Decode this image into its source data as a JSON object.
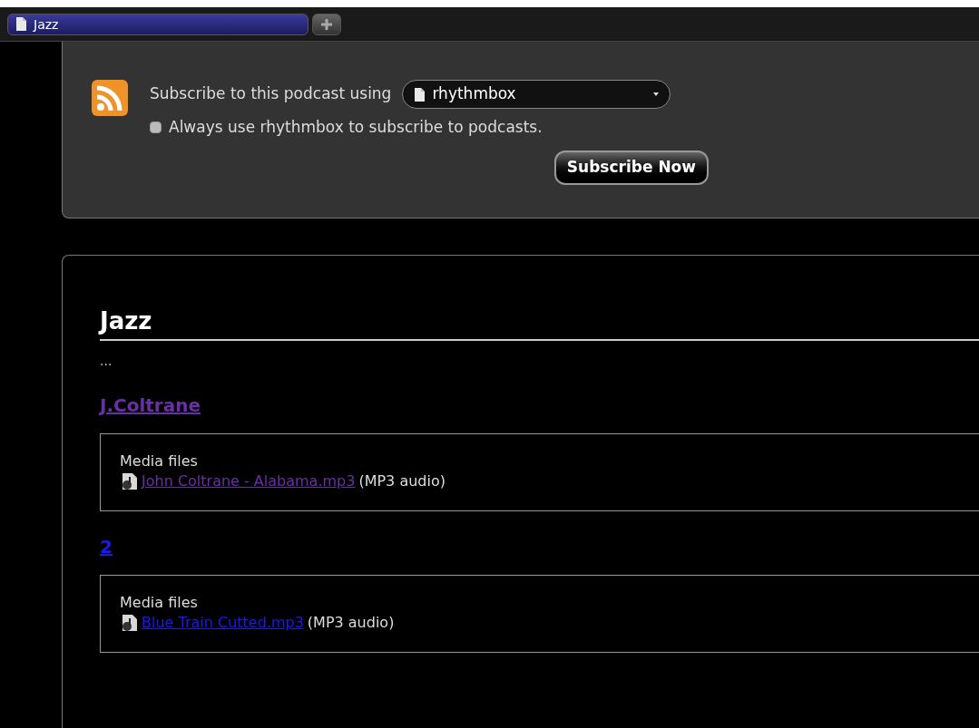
{
  "tabs": [
    {
      "label": "Jazz",
      "selected": true
    }
  ],
  "subscribe": {
    "label": "Subscribe to this podcast using",
    "reader": "rhythmbox",
    "always_label": "Always use rhythmbox to subscribe to podcasts.",
    "always_checked": false,
    "button": "Subscribe Now"
  },
  "feed": {
    "title": "Jazz",
    "subtitle": "...",
    "entries": [
      {
        "title": "J.Coltrane",
        "visited": true,
        "section": "Media files",
        "file": "John Coltrane - Alabama.mp3",
        "file_visited": true,
        "type": "(MP3 audio)"
      },
      {
        "title": "2",
        "visited": false,
        "section": "Media files",
        "file": "Blue Train Cutted.mp3",
        "file_visited": false,
        "type": "(MP3 audio)"
      }
    ]
  }
}
